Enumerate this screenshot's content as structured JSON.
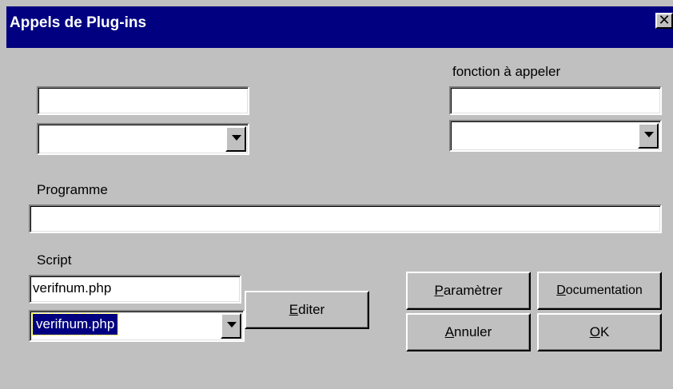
{
  "window": {
    "title": "Appels de Plug-ins",
    "close_glyph": "✕"
  },
  "fields": {
    "field1_value": "",
    "dropdown1_value": "",
    "function_label": "fonction à appeler",
    "function_value": "",
    "dropdown2_value": "",
    "program_label": "Programme",
    "program_value": "",
    "script_label": "Script",
    "script_value": "verifnum.php",
    "script_dropdown_value": "verifnum.php"
  },
  "buttons": {
    "edit": {
      "mnemonic": "E",
      "rest": "diter"
    },
    "parametrer": {
      "mnemonic": "P",
      "rest": "aramètrer"
    },
    "documentation": {
      "mnemonic": "D",
      "rest": "ocumentation"
    },
    "annuler": {
      "mnemonic": "A",
      "rest": "nnuler"
    },
    "ok": {
      "mnemonic": "O",
      "rest": "K"
    }
  },
  "icons": {
    "close": "close-icon",
    "dropdown": "chevron-down-icon"
  }
}
